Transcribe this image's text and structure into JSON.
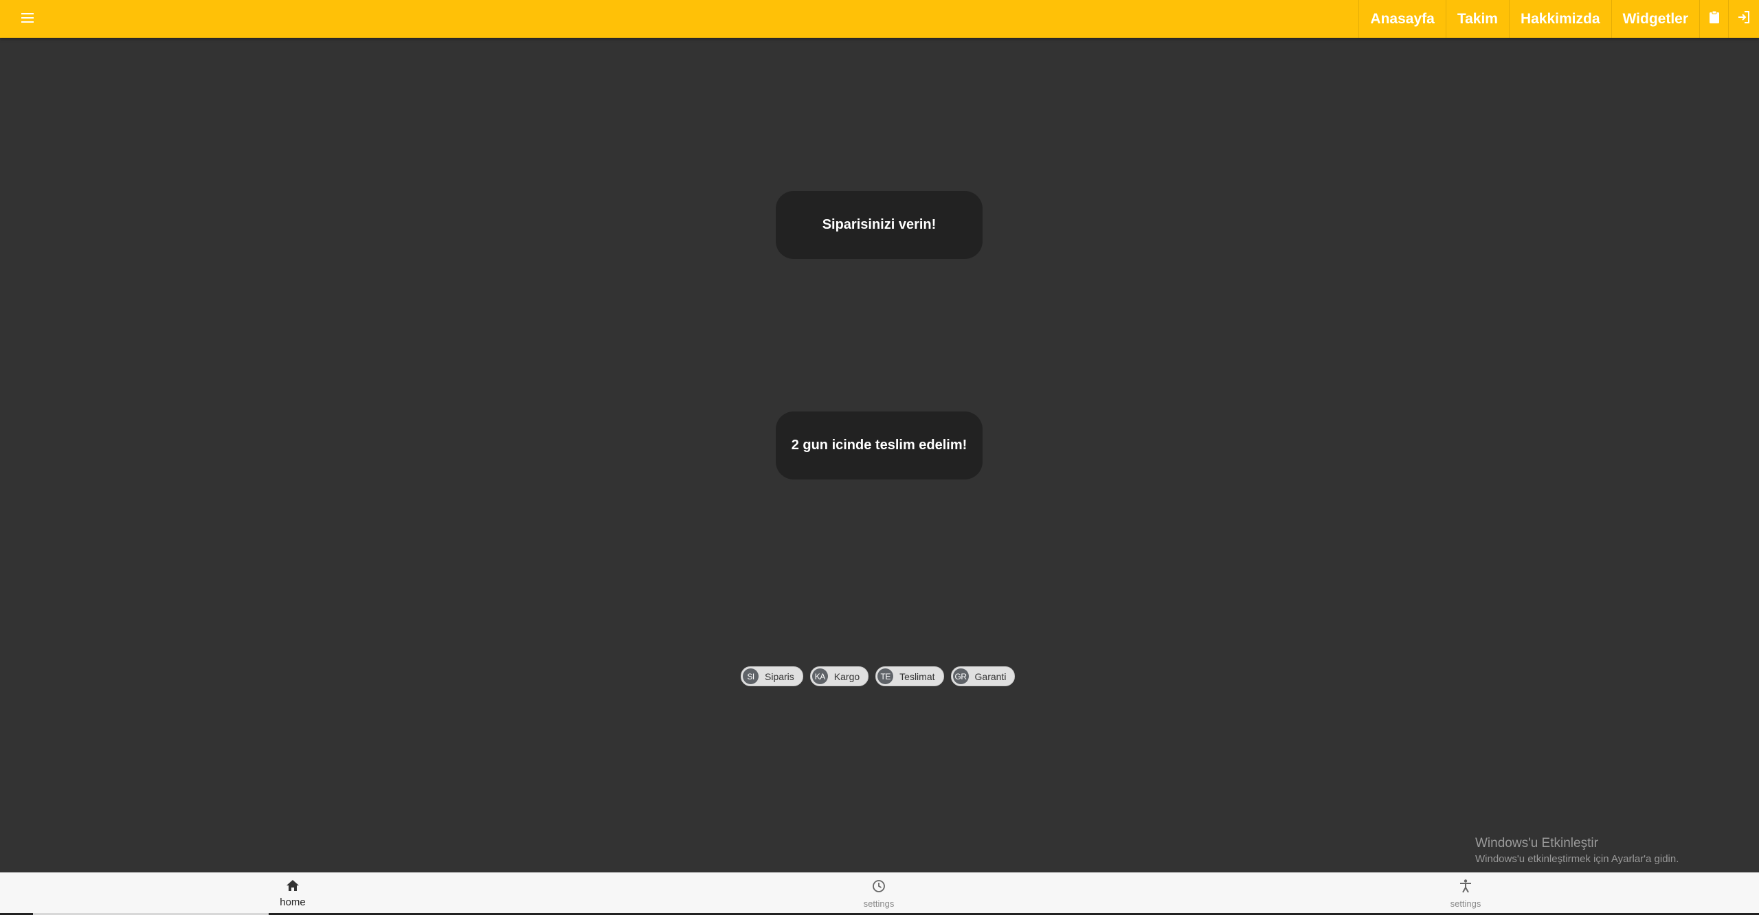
{
  "topbar": {
    "menu_icon": "menu-icon",
    "nav": [
      "Anasayfa",
      "Takim",
      "Hakkimizda",
      "Widgetler"
    ],
    "clipboard_icon": "clipboard-icon",
    "login_icon": "login-icon",
    "bg_color": "#ffc107"
  },
  "cards": {
    "first": "Siparisinizi verin!",
    "second": "2 gun icinde teslim edelim!"
  },
  "chips": [
    {
      "avatar": "SI",
      "label": "Siparis"
    },
    {
      "avatar": "KA",
      "label": "Kargo"
    },
    {
      "avatar": "TE",
      "label": "Teslimat"
    },
    {
      "avatar": "GR",
      "label": "Garanti"
    }
  ],
  "watermark": {
    "title": "Windows'u Etkinleştir",
    "subtitle": "Windows'u etkinleştirmek için Ayarlar'a gidin."
  },
  "bottom_nav": [
    {
      "icon": "home-icon",
      "label": "home",
      "active": true
    },
    {
      "icon": "clock-icon",
      "label": "settings",
      "active": false
    },
    {
      "icon": "accessibility-icon",
      "label": "settings",
      "active": false
    }
  ]
}
